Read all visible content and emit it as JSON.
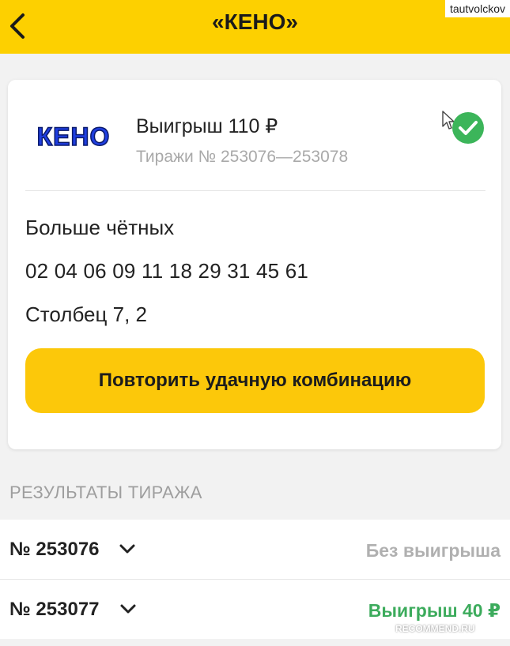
{
  "header": {
    "title": "«КЕНО»"
  },
  "watermark": {
    "user": "tautvolckov",
    "site": "RECOMMEND.RU"
  },
  "ticket": {
    "logo_text": "КЕНО",
    "prize": "Выигрыш 110 ₽",
    "draws": "Тиражи № 253076—253078",
    "bet_type": "Больше чётных",
    "numbers": "02 04 06 09 11 18 29 31 45 61",
    "column": "Столбец 7, 2",
    "repeat_button": "Повторить удачную комбинацию",
    "check_icon": "check-circle-icon",
    "accent_color": "#fcc80a",
    "check_color": "#3cb55a"
  },
  "results": {
    "section_title": "РЕЗУЛЬТАТЫ ТИРАЖА",
    "rows": [
      {
        "number": "№ 253076",
        "status": "Без выигрыша"
      },
      {
        "number": "№ 253077",
        "status": "Выигрыш 40 ₽"
      }
    ]
  }
}
